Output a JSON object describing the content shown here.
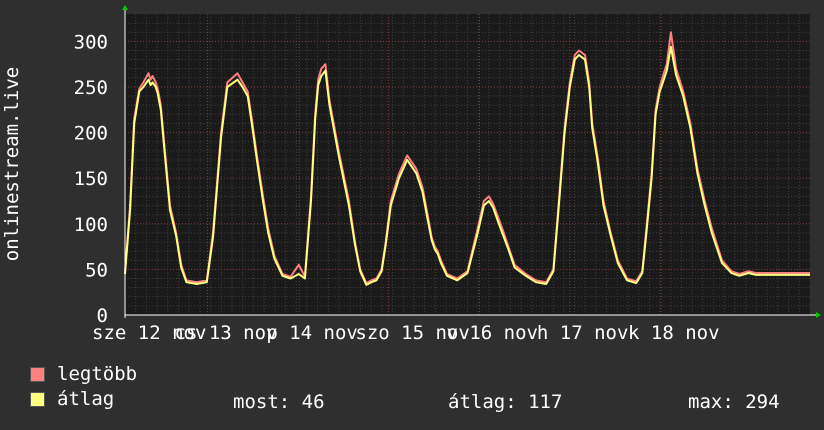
{
  "chart_data": {
    "type": "line",
    "ylabel": "onlinestream.live",
    "ylim": [
      0,
      330
    ],
    "yticks": [
      0,
      50,
      100,
      150,
      200,
      250,
      300
    ],
    "xlim": [
      0,
      1
    ],
    "grid": true,
    "xtick_labels": [
      {
        "text": "sze  12 nov",
        "x": 0.0
      },
      {
        "text": "cs  13 nov",
        "x": 0.1205
      },
      {
        "text": "p  14 nov",
        "x": 0.2545
      },
      {
        "text": "szo  15 nov",
        "x": 0.3845
      },
      {
        "text": "v  16 nov",
        "x": 0.5175
      },
      {
        "text": "h  17 nov",
        "x": 0.6495
      },
      {
        "text": "k  18 nov",
        "x": 0.7825
      }
    ],
    "series": [
      {
        "name": "legtöbb",
        "color": "#ff8080",
        "x": [
          0.0,
          0.0075,
          0.0134,
          0.0209,
          0.0269,
          0.0343,
          0.0373,
          0.0403,
          0.0448,
          0.0478,
          0.0522,
          0.0582,
          0.0657,
          0.0746,
          0.0821,
          0.0896,
          0.1045,
          0.1194,
          0.1284,
          0.1403,
          0.1493,
          0.1642,
          0.1716,
          0.1791,
          0.1851,
          0.1925,
          0.2015,
          0.209,
          0.2179,
          0.2299,
          0.2418,
          0.2537,
          0.2627,
          0.2716,
          0.2776,
          0.2821,
          0.2866,
          0.2925,
          0.2985,
          0.3119,
          0.3269,
          0.3358,
          0.3433,
          0.3522,
          0.3597,
          0.3672,
          0.3746,
          0.3806,
          0.3881,
          0.4,
          0.4119,
          0.4254,
          0.4343,
          0.4418,
          0.4478,
          0.4522,
          0.4567,
          0.4612,
          0.4701,
          0.4851,
          0.5,
          0.5149,
          0.5239,
          0.5313,
          0.5373,
          0.5433,
          0.5507,
          0.5597,
          0.5687,
          0.5851,
          0.6,
          0.6149,
          0.6254,
          0.6328,
          0.6418,
          0.6493,
          0.6567,
          0.6627,
          0.6716,
          0.6776,
          0.6821,
          0.6896,
          0.6985,
          0.709,
          0.7194,
          0.7328,
          0.7463,
          0.7552,
          0.7612,
          0.7687,
          0.7746,
          0.7806,
          0.7866,
          0.791,
          0.797,
          0.8045,
          0.8149,
          0.8254,
          0.8358,
          0.8463,
          0.8567,
          0.8716,
          0.8851,
          0.897,
          0.9104,
          0.9209,
          0.9328,
          0.9403,
          0.9463,
          0.9522,
          0.9582,
          0.9642,
          0.9716,
          0.9791,
          0.9896,
          1.0
        ],
        "values": [
          48,
          120,
          215,
          248,
          255,
          265,
          258,
          262,
          255,
          248,
          230,
          180,
          120,
          90,
          55,
          38,
          36,
          38,
          90,
          200,
          255,
          265,
          255,
          245,
          215,
          175,
          130,
          95,
          65,
          45,
          42,
          55,
          42,
          130,
          220,
          258,
          270,
          275,
          235,
          180,
          125,
          80,
          50,
          35,
          38,
          40,
          50,
          80,
          125,
          155,
          175,
          160,
          140,
          110,
          85,
          75,
          70,
          60,
          45,
          40,
          48,
          95,
          125,
          130,
          122,
          110,
          95,
          75,
          55,
          45,
          38,
          36,
          50,
          120,
          205,
          255,
          285,
          290,
          285,
          255,
          210,
          175,
          125,
          90,
          60,
          40,
          37,
          48,
          95,
          155,
          225,
          250,
          265,
          275,
          310,
          270,
          245,
          210,
          160,
          125,
          95,
          60,
          48,
          45,
          48,
          46,
          46,
          46,
          46,
          46,
          46,
          46,
          46,
          46,
          46,
          46
        ]
      },
      {
        "name": "átlag",
        "color": "#ffff80",
        "x": [
          0.0,
          0.0075,
          0.0134,
          0.0209,
          0.0269,
          0.0343,
          0.0373,
          0.0403,
          0.0448,
          0.0478,
          0.0522,
          0.0582,
          0.0657,
          0.0746,
          0.0821,
          0.0896,
          0.1045,
          0.1194,
          0.1284,
          0.1403,
          0.1493,
          0.1642,
          0.1716,
          0.1791,
          0.1851,
          0.1925,
          0.2015,
          0.209,
          0.2179,
          0.2299,
          0.2418,
          0.2537,
          0.2627,
          0.2716,
          0.2776,
          0.2821,
          0.2866,
          0.2925,
          0.2985,
          0.3119,
          0.3269,
          0.3358,
          0.3433,
          0.3522,
          0.3597,
          0.3672,
          0.3746,
          0.3806,
          0.3881,
          0.4,
          0.4119,
          0.4254,
          0.4343,
          0.4418,
          0.4478,
          0.4522,
          0.4567,
          0.4612,
          0.4701,
          0.4851,
          0.5,
          0.5149,
          0.5239,
          0.5313,
          0.5373,
          0.5433,
          0.5507,
          0.5597,
          0.5687,
          0.5851,
          0.6,
          0.6149,
          0.6254,
          0.6328,
          0.6418,
          0.6493,
          0.6567,
          0.6627,
          0.6716,
          0.6776,
          0.6821,
          0.6896,
          0.6985,
          0.709,
          0.7194,
          0.7328,
          0.7463,
          0.7552,
          0.7612,
          0.7687,
          0.7746,
          0.7806,
          0.7866,
          0.791,
          0.797,
          0.8045,
          0.8149,
          0.8254,
          0.8358,
          0.8463,
          0.8567,
          0.8716,
          0.8851,
          0.897,
          0.9104,
          0.9209,
          0.9328,
          0.9403,
          0.9463,
          0.9522,
          0.9582,
          0.9642,
          0.9716,
          0.9791,
          0.9896,
          1.0
        ],
        "values": [
          45,
          115,
          210,
          245,
          250,
          258,
          252,
          255,
          250,
          243,
          225,
          175,
          115,
          87,
          52,
          36,
          34,
          36,
          85,
          195,
          250,
          258,
          250,
          240,
          210,
          170,
          125,
          90,
          62,
          43,
          40,
          45,
          40,
          125,
          215,
          252,
          262,
          268,
          230,
          175,
          120,
          77,
          48,
          33,
          36,
          38,
          48,
          77,
          120,
          150,
          170,
          155,
          135,
          105,
          82,
          72,
          67,
          57,
          43,
          38,
          46,
          90,
          120,
          125,
          118,
          105,
          90,
          72,
          52,
          43,
          36,
          34,
          48,
          115,
          200,
          250,
          280,
          285,
          280,
          250,
          205,
          170,
          120,
          87,
          57,
          38,
          35,
          46,
          90,
          150,
          220,
          245,
          258,
          268,
          294,
          263,
          240,
          205,
          155,
          120,
          90,
          57,
          46,
          43,
          46,
          44,
          44,
          44,
          44,
          44,
          44,
          44,
          44,
          44,
          44,
          44
        ]
      }
    ]
  },
  "legend": {
    "items": [
      {
        "label": "legtöbb",
        "color": "#ff8080"
      },
      {
        "label": "átlag",
        "color": "#ffff80"
      }
    ],
    "stats": {
      "now": "most: 46",
      "avg": "átlag: 117",
      "max": "max: 294"
    }
  }
}
